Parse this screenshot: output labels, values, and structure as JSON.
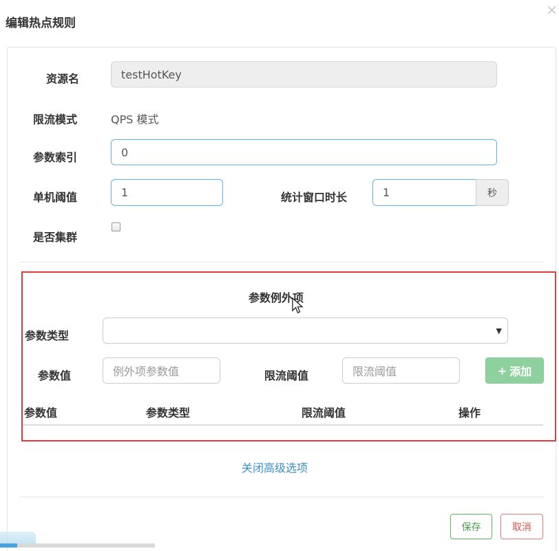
{
  "dialog": {
    "title": "编辑热点规则",
    "close_glyph": "×"
  },
  "form": {
    "resource_label": "资源名",
    "resource_value": "testHotKey",
    "mode_label": "限流模式",
    "mode_value": "QPS 模式",
    "param_index_label": "参数索引",
    "param_index_value": "0",
    "threshold_label": "单机阈值",
    "threshold_value": "1",
    "window_label": "统计窗口时长",
    "window_value": "1",
    "window_unit": "秒",
    "cluster_label": "是否集群",
    "cluster_checked": false
  },
  "exceptions": {
    "title": "参数例外项",
    "param_type_label": "参数类型",
    "param_type_selected": "",
    "param_value_label": "参数值",
    "param_value_placeholder": "例外项参数值",
    "limit_label": "限流阈值",
    "limit_placeholder": "限流阈值",
    "add_icon": "plus-icon",
    "add_glyph": "+",
    "add_label": "添加",
    "table_headers": [
      "参数值",
      "参数类型",
      "限流阈值",
      "操作"
    ]
  },
  "advanced_link": "关闭高级选项",
  "footer": {
    "save_label": "保存",
    "cancel_label": "取消"
  },
  "colors": {
    "highlight_border": "#e03a3a",
    "link": "#3a8fc7",
    "add_button": "#8fd19e",
    "save": "#5cb85c",
    "cancel": "#d9534f"
  },
  "page_scroll_progress": 0.11
}
